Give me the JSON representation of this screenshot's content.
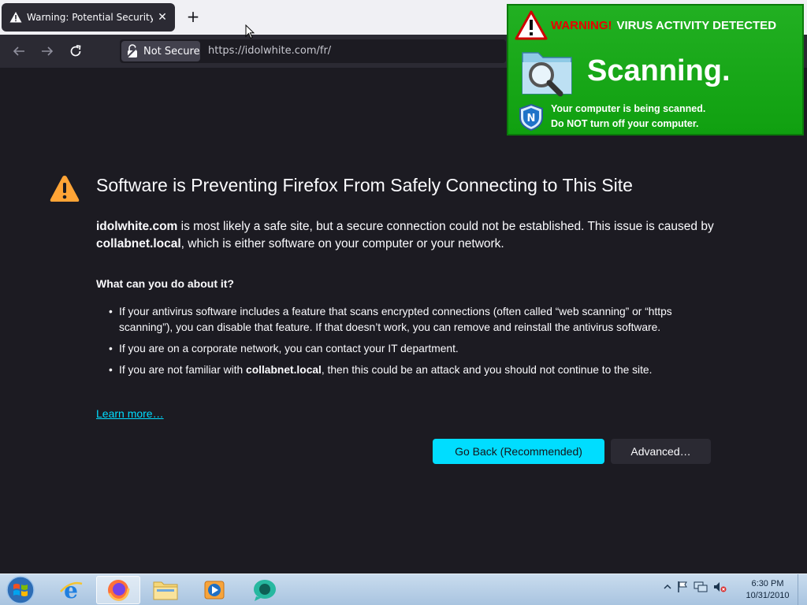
{
  "browser": {
    "tab": {
      "title": "Warning: Potential Security Risk",
      "close_label": "✕"
    },
    "new_tab_label": "+",
    "address": {
      "security_label": "Not Secure",
      "url": "https://idolwhite.com/fr/"
    }
  },
  "page": {
    "title": "Software is Preventing Firefox From Safely Connecting to This Site",
    "intro": {
      "site": "idolwhite.com",
      "text1": " is most likely a safe site, but a secure connection could not be established. This issue is caused by ",
      "software": "collabnet.local",
      "text2": ", which is either software on your computer or your network."
    },
    "subheading": "What can you do about it?",
    "bullets": {
      "b1": "If your antivirus software includes a feature that scans encrypted connections (often called “web scanning” or “https scanning”), you can disable that feature. If that doesn’t work, you can remove and reinstall the antivirus software.",
      "b2": "If you are on a corporate network, you can contact your IT department.",
      "b3_pre": "If you are not familiar with ",
      "b3_bold": "collabnet.local",
      "b3_post": ", then this could be an attack and you should not continue to the site."
    },
    "learn_more": "Learn more…",
    "go_back_label": "Go Back (Recommended)",
    "advanced_label": "Advanced…"
  },
  "popup": {
    "warning_word": "WARNING!",
    "headline": "VIRUS ACTIVITY DETECTED",
    "scanning": "Scanning.",
    "line1": "Your computer is being scanned.",
    "line2_pre": "Do ",
    "line2_bold": "NOT",
    "line2_post": " turn off your computer.",
    "shield_letter": "N"
  },
  "taskbar": {
    "apps": [
      "internet-explorer-icon",
      "firefox-icon",
      "file-explorer-icon",
      "media-player-icon",
      "chat-app-icon"
    ],
    "clock_time": "6:30 PM",
    "clock_date": "10/31/2010"
  },
  "colors": {
    "accent": "#00ddff",
    "page_bg": "#1c1b22",
    "popup_green": "#18a818",
    "popup_red": "#e80000"
  }
}
